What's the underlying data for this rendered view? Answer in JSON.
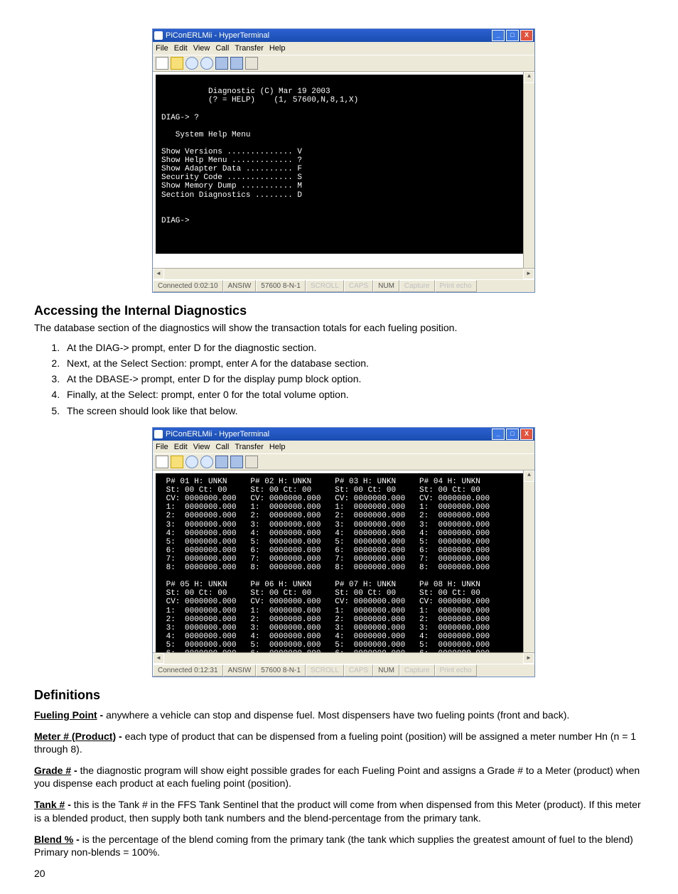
{
  "terminal1": {
    "title": "PiConERLMii - HyperTerminal",
    "menus": [
      "File",
      "Edit",
      "View",
      "Call",
      "Transfer",
      "Help"
    ],
    "content_lines": [
      "",
      "          Diagnostic (C) Mar 19 2003",
      "          (? = HELP)    (1, 57600,N,8,1,X)",
      "",
      "DIAG-> ?",
      "",
      "   System Help Menu",
      "",
      "Show Versions .............. V",
      "Show Help Menu ............. ?",
      "Show Adapter Data .......... F",
      "Security Code .............. S",
      "Show Memory Dump ........... M",
      "Section Diagnostics ........ D",
      "",
      "",
      "DIAG->"
    ],
    "status": {
      "connected": "Connected 0:02:10",
      "detect": "ANSIW",
      "port": "57600 8-N-1",
      "indicators": [
        "SCROLL",
        "CAPS",
        "NUM",
        "Capture",
        "Print echo"
      ]
    }
  },
  "section1": {
    "heading": "Accessing the Internal Diagnostics",
    "intro": "The database section of the diagnostics will show the transaction totals for each fueling position.",
    "steps": [
      "At the DIAG-> prompt, enter D for the diagnostic section.",
      "Next, at the Select Section: prompt, enter A for the database section.",
      "At the DBASE-> prompt, enter D for the display pump block option.",
      "Finally, at the Select: prompt, enter 0 for the total volume option.",
      "The screen should look like that below."
    ]
  },
  "terminal2": {
    "title": "PiConERLMii - HyperTerminal",
    "menus": [
      "File",
      "Edit",
      "View",
      "Call",
      "Transfer",
      "Help"
    ],
    "pump_block_template": {
      "header": "P# {n} H: UNKN",
      "st_line": "St: 00 Ct: 00",
      "cv_line": "CV: 0000000.000",
      "meter_line": "{i}:  0000000.000",
      "meter_count": 8
    },
    "pump_numbers_row1": [
      "01",
      "02",
      "03",
      "04"
    ],
    "pump_numbers_row2": [
      "05",
      "06",
      "07",
      "08"
    ],
    "status": {
      "connected": "Connected 0:12:31",
      "detect": "ANSIW",
      "port": "57600 8-N-1",
      "indicators": [
        "SCROLL",
        "CAPS",
        "NUM",
        "Capture",
        "Print echo"
      ]
    }
  },
  "definitions": {
    "heading": "Definitions",
    "items": [
      {
        "term": "Fueling Point",
        "sep": " - ",
        "text": "anywhere a vehicle can stop and dispense fuel. Most dispensers have two fueling points (front and back)."
      },
      {
        "term": "Meter # (Product)",
        "sep": " - ",
        "text": "each type of product that can be dispensed from a fueling point (position) will be assigned a meter number Hn (n = 1 through 8)."
      },
      {
        "term": "Grade #",
        "sep": " - ",
        "text": "the diagnostic program will show eight possible grades for each Fueling Point and assigns a Grade # to a Meter (product) when you dispense each product at each fueling point (position)."
      },
      {
        "term": "Tank #",
        "sep": " - ",
        "text": "this is the Tank # in the FFS Tank Sentinel that the product will come from when dispensed from this Meter (product). If this meter is a blended product, then supply both tank numbers and the blend-percentage from the primary tank."
      },
      {
        "term": "Blend %",
        "sep": " - ",
        "text": "is the percentage of the blend coming from the primary tank (the tank which supplies the greatest amount of fuel to the blend) Primary non-blends = 100%."
      }
    ]
  },
  "page_number": "20"
}
